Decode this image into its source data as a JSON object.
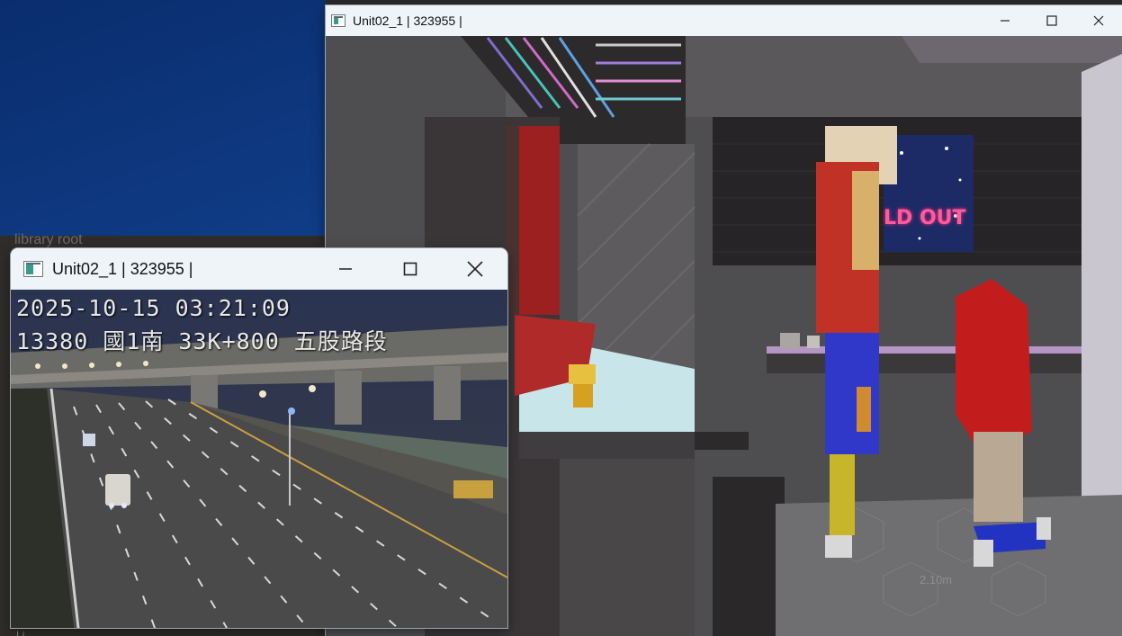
{
  "desktop": {
    "background_label": "library root",
    "bottom_label": "Li"
  },
  "main_window": {
    "title": "Unit02_1 | 323955 |",
    "minimize_label": "Minimize",
    "maximize_label": "Maximize",
    "close_label": "Close",
    "scene": {
      "sign_text": "LD OUT",
      "measurement": "2.10m"
    }
  },
  "camera_window": {
    "title": "Unit02_1 | 323955 |",
    "minimize_label": "Minimize",
    "maximize_label": "Maximize",
    "close_label": "Close",
    "overlay": {
      "datetime": "2025-10-15 03:21:09",
      "location": "13380 國1南 33K+800 五股路段"
    }
  },
  "colors": {
    "desktop_accent": "#11428f",
    "titlebar": "#eff4f8",
    "sign_pink": "#ff5a9c"
  }
}
